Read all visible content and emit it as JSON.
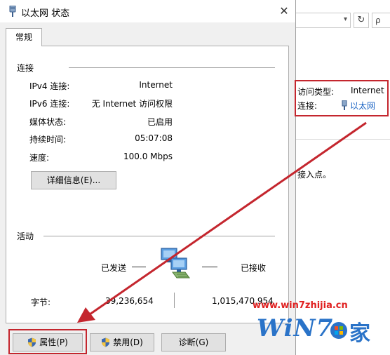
{
  "dialog": {
    "title": "以太网 状态",
    "close_symbol": "✕",
    "tab_label": "常规"
  },
  "connection": {
    "section_label": "连接",
    "rows": [
      {
        "label": "IPv4 连接:",
        "value": "Internet"
      },
      {
        "label": "IPv6 连接:",
        "value": "无 Internet 访问权限"
      },
      {
        "label": "媒体状态:",
        "value": "已启用"
      },
      {
        "label": "持续时间:",
        "value": "05:07:08"
      },
      {
        "label": "速度:",
        "value": "100.0 Mbps"
      }
    ],
    "details_button": "详细信息(E)..."
  },
  "activity": {
    "section_label": "活动",
    "sent_label": "已发送",
    "received_label": "已接收",
    "bytes_label": "字节:",
    "bytes_sent": "39,236,654",
    "bytes_received": "1,015,470,954"
  },
  "buttons": {
    "properties": "属性(P)",
    "disable": "禁用(D)",
    "diagnose": "诊断(G)"
  },
  "background": {
    "access_type_label": "访问类型:",
    "access_type_value": "Internet",
    "connection_label": "连接:",
    "connection_value": "以太网",
    "partial_text": "接入点。",
    "search_placeholder": "ρ"
  },
  "watermark": {
    "url": "www.win7zhijia.cn",
    "logo_text": "WiN7",
    "logo_char": "家"
  },
  "colors": {
    "highlight_red": "#c4262e",
    "link_blue": "#1a63c4",
    "dialog_bg": "#f0f0f0",
    "button_bg": "#e1e1e1"
  }
}
